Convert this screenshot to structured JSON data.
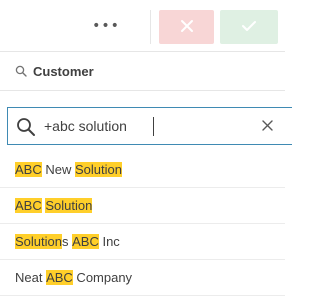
{
  "toolbar": {
    "more_label": "•••",
    "cancel_icon": "close-icon",
    "confirm_icon": "checkmark-icon",
    "cancel_color": "#f8d6d6",
    "confirm_color": "#dff0e3"
  },
  "field": {
    "title": "Customer",
    "icon": "search-icon"
  },
  "search": {
    "value": "+abc solution",
    "icon": "search-icon",
    "clear_icon": "close-icon"
  },
  "highlight_color": "#ffcf2a",
  "results": [
    {
      "segments": [
        {
          "text": "ABC",
          "hl": true
        },
        {
          "text": " New ",
          "hl": false
        },
        {
          "text": "Solution",
          "hl": true
        }
      ]
    },
    {
      "segments": [
        {
          "text": "ABC",
          "hl": true
        },
        {
          "text": " ",
          "hl": false
        },
        {
          "text": "Solution",
          "hl": true
        }
      ]
    },
    {
      "segments": [
        {
          "text": "Solution",
          "hl": true
        },
        {
          "text": "s ",
          "hl": false
        },
        {
          "text": "ABC",
          "hl": true
        },
        {
          "text": " Inc",
          "hl": false
        }
      ]
    },
    {
      "segments": [
        {
          "text": "Neat ",
          "hl": false
        },
        {
          "text": "ABC",
          "hl": true
        },
        {
          "text": " Company",
          "hl": false
        }
      ]
    }
  ]
}
